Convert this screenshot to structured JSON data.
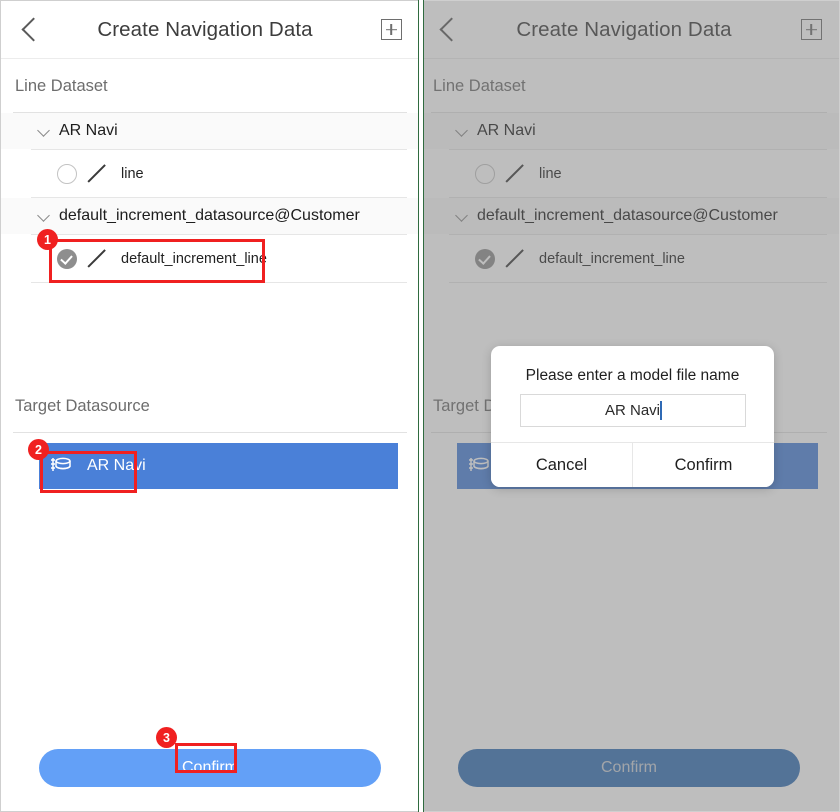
{
  "header": {
    "back_icon": "chevron-left-icon",
    "title": "Create Navigation Data",
    "add_icon": "plus-square-icon"
  },
  "line_dataset": {
    "section_label": "Line Dataset",
    "groups": [
      {
        "caret_icon": "chevron-down-icon",
        "label": "AR Navi",
        "items": [
          {
            "label": "line",
            "checked": false,
            "line_icon": "slash-line-icon",
            "check_icon": "radio-unchecked-icon"
          }
        ]
      },
      {
        "caret_icon": "chevron-down-icon",
        "label": "default_increment_datasource@Customer",
        "items": [
          {
            "label": "default_increment_line",
            "checked": true,
            "line_icon": "slash-line-icon",
            "check_icon": "check-circle-icon"
          }
        ]
      }
    ]
  },
  "target_datasource": {
    "section_label": "Target Datasource",
    "items": [
      {
        "label": "AR Navi",
        "icon": "database-icon",
        "selected": true
      }
    ]
  },
  "bottom": {
    "confirm_label": "Confirm"
  },
  "dialog": {
    "title": "Please enter a model file name",
    "input_value": "AR Navi",
    "input_placeholder": "",
    "cancel_label": "Cancel",
    "confirm_label": "Confirm"
  },
  "annotations": {
    "badge_color": "#f02020",
    "steps": [
      {
        "number": "1",
        "target": "default_increment_line row"
      },
      {
        "number": "2",
        "target": "AR Navi target datasource"
      },
      {
        "number": "3",
        "target": "Confirm button"
      }
    ]
  },
  "colors": {
    "accent_blue": "#63a0f7",
    "selected_row_blue": "#4a80d8",
    "dialog_confirm_blue": "#336fb5",
    "annotation_red": "#f02020",
    "divider_green": "#2f6b3f",
    "title_text": "#3d3d3d",
    "muted_text": "#6d6d6d"
  }
}
